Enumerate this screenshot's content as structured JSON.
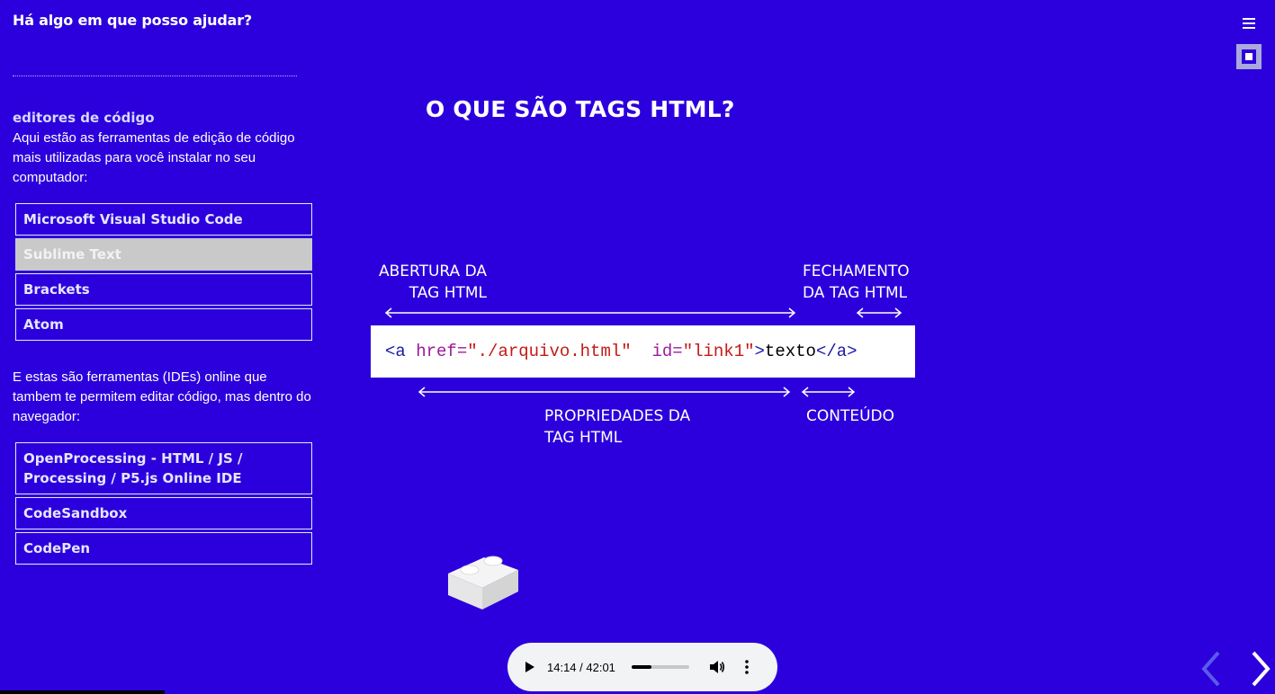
{
  "header": {
    "question": "Há algo em que posso ajudar?"
  },
  "editors": {
    "heading": "editores de código",
    "description": "Aqui estão as ferramentas de edição de código mais utilizadas para você instalar no seu computador:",
    "items": [
      {
        "label": "Microsoft Visual Studio Code",
        "active": false
      },
      {
        "label": "Sublime Text",
        "active": true
      },
      {
        "label": "Brackets",
        "active": false
      },
      {
        "label": "Atom",
        "active": false
      }
    ]
  },
  "online": {
    "description": "E estas são ferramentas (IDEs) online que tambem te permitem editar código, mas dentro do navegador:",
    "items": [
      {
        "label": "OpenProcessing - HTML / JS / Processing / P5.js Online IDE"
      },
      {
        "label": "CodeSandbox"
      },
      {
        "label": "CodePen"
      }
    ]
  },
  "slide": {
    "title": "O QUE SÃO TAGS HTML?",
    "label_open_line1": "ABERTURA DA",
    "label_open_line2": "TAG HTML",
    "label_close_line1": "FECHAMENTO",
    "label_close_line2": "DA TAG HTML",
    "label_props_line1": "PROPRIEDADES DA",
    "label_props_line2": "TAG HTML",
    "label_content": "CONTEÚDO",
    "code": {
      "open": "<a",
      "attr1": " href=",
      "val1": "\"./arquivo.html\"",
      "attr2": "  id=",
      "val2": "\"link1\"",
      "close_open": ">",
      "content": "texto",
      "end_tag": "</a>"
    },
    "colors": {
      "tag": "#1a1aa6",
      "attr": "#9a1b9a",
      "value": "#c41a16"
    }
  },
  "audio": {
    "time": "14:14 / 42:01",
    "progress": 0.34
  },
  "colors": {
    "background": "#2c00dc",
    "active_item": "#c9c9c9"
  },
  "icons": [
    "menu-icon",
    "stop-icon",
    "play-icon",
    "volume-icon",
    "more-icon",
    "chevron-left-icon",
    "chevron-right-icon",
    "lego-brick-icon"
  ]
}
